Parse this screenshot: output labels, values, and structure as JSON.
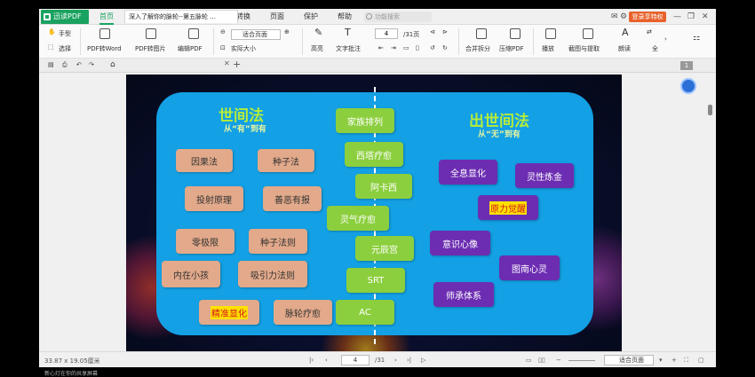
{
  "app": {
    "logo": "迅读PDF",
    "menus": [
      "首页",
      "阅读",
      "注释",
      "编辑",
      "转换",
      "页面",
      "保护",
      "帮助"
    ],
    "search_placeholder": "功能搜索",
    "vip_label": "登录享特权"
  },
  "ribbon": {
    "hand": "手型",
    "select": "选择",
    "pdf_to_word": "PDF转Word",
    "pdf_to_image": "PDF转图片",
    "edit_pdf": "编辑PDF",
    "fit_page": "适合页面",
    "actual_size": "实际大小",
    "highlight": "高亮",
    "text_note": "文字批注",
    "page_current": "4",
    "page_total": "/31页",
    "merge_split": "合并拆分",
    "compress": "压缩PDF",
    "play": "播放",
    "screenshot": "截图与提取",
    "read": "朗读",
    "translate": "全"
  },
  "tabs": {
    "doc_title": "深入了解你的脉轮--第五脉轮 ...",
    "page_badge": "1"
  },
  "slide": {
    "left_title": "世间法",
    "left_sub": "从“有”到有",
    "right_title": "出世间法",
    "right_sub": "从“无”到有",
    "left_boxes": [
      "因果法",
      "种子法",
      "投射原理",
      "善恶有报",
      "零极限",
      "种子法则",
      "内在小孩",
      "吸引力法则",
      "精准显化",
      "脉轮疗愈"
    ],
    "center_boxes": [
      "家族排列",
      "西塔疗愈",
      "阿卡西",
      "灵气疗愈",
      "元辰宫",
      "SRT",
      "AC"
    ],
    "right_boxes": [
      "全息显化",
      "灵性炼金",
      "原力觉醒",
      "意识心像",
      "图南心灵",
      "师承体系"
    ]
  },
  "status": {
    "size": "33.87 x 19.05厘米",
    "page_current": "4",
    "page_total": "/31",
    "zoom": "适合页面"
  },
  "footer": "新心灯在你的共享屏幕"
}
